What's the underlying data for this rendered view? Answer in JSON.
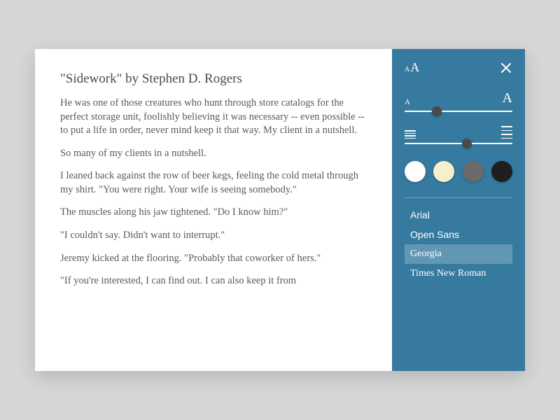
{
  "reader": {
    "title": "\"Sidework\" by Stephen D. Rogers",
    "paragraphs": [
      "He was one of those creatures who hunt through store catalogs for the perfect storage unit, foolishly believing it was necessary -- even possible -- to put a life in order, never mind keep it that way. My client in a nutshell.",
      "So many of my clients in a nutshell.",
      "I leaned back against the row of beer kegs, feeling the cold metal through my shirt. \"You were right. Your wife is seeing somebody.\"",
      "The muscles along his jaw tightened. \"Do I know him?\"",
      "\"I couldn't say. Didn't want to interrupt.\"",
      "Jeremy kicked at the flooring. \"Probably that coworker of hers.\"",
      "\"If you're interested, I can find out. I can also keep it from"
    ]
  },
  "panel": {
    "font_size_slider": {
      "min_label": "A",
      "max_label": "A",
      "value_percent": 30
    },
    "spacing_slider": {
      "value_percent": 58
    },
    "themes": [
      {
        "name": "white",
        "color": "#ffffff"
      },
      {
        "name": "sepia",
        "color": "#f5f0c9"
      },
      {
        "name": "gray",
        "color": "#6a6a6a"
      },
      {
        "name": "black",
        "color": "#1e1e1e"
      }
    ],
    "fonts": [
      {
        "label": "Arial",
        "class": "font-arial",
        "selected": false
      },
      {
        "label": "Open Sans",
        "class": "font-opensans",
        "selected": false
      },
      {
        "label": "Georgia",
        "class": "font-georgia",
        "selected": true
      },
      {
        "label": "Times New Roman",
        "class": "font-times",
        "selected": false
      }
    ]
  }
}
